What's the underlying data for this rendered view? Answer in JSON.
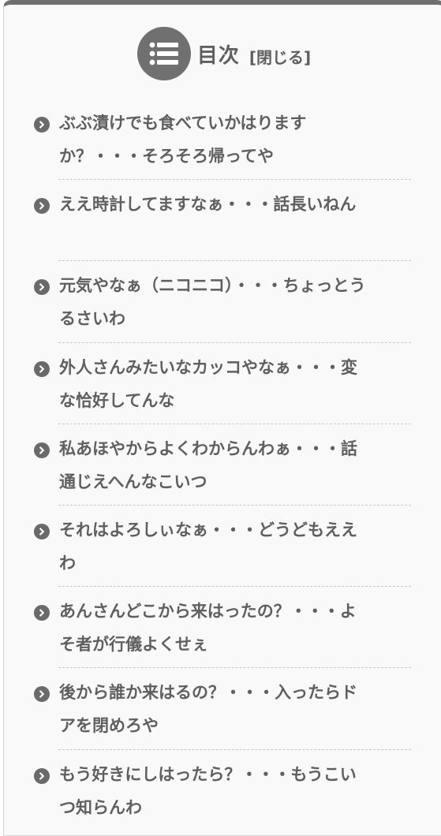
{
  "toc": {
    "title": "目次",
    "toggle_label": "[閉じる]",
    "colors": {
      "text": "#5f5f5f",
      "icon": "#707070",
      "background": "#f9f9f9"
    },
    "icons": {
      "header": "list-icon",
      "bullet": "chevron-right-circle-icon"
    },
    "items": [
      {
        "label": "ぶぶ漬けでも食べていかはりますか？・・・そろそろ帰ってや"
      },
      {
        "label": "ええ時計してますなぁ・・・話長いねん"
      },
      {
        "label": "元気やなぁ（ニコニコ）・・・ちょっとうるさいわ"
      },
      {
        "label": "外人さんみたいなカッコやなぁ・・・変な恰好してんな"
      },
      {
        "label": "私あほやからよくわからんわぁ・・・話通じえへんなこいつ"
      },
      {
        "label": "それはよろしぃなぁ・・・どうどもええわ"
      },
      {
        "label": "あんさんどこから来はったの？・・・よそ者が行儀よくせぇ"
      },
      {
        "label": "後から誰か来はるの？・・・入ったらドアを閉めろや"
      },
      {
        "label": "もう好きにしはったら？・・・もうこいつ知らんわ"
      }
    ]
  }
}
